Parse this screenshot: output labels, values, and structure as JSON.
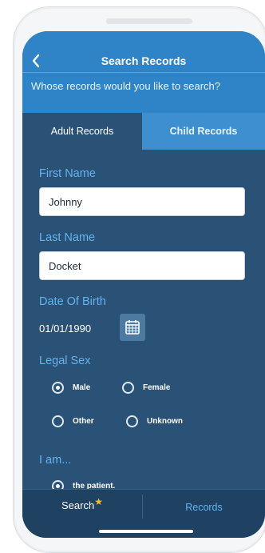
{
  "header": {
    "title": "Search Records",
    "back_icon": "chevron-left-icon",
    "subtitle": "Whose records would you like to search?"
  },
  "tabs": [
    {
      "label": "Adult Records",
      "active": true
    },
    {
      "label": "Child Records",
      "active": false
    }
  ],
  "form": {
    "first_name": {
      "label": "First Name",
      "value": "Johnny"
    },
    "last_name": {
      "label": "Last Name",
      "value": "Docket"
    },
    "dob": {
      "label": "Date Of Birth",
      "value": "01/01/1990",
      "icon": "calendar-icon"
    },
    "legal_sex": {
      "label": "Legal Sex",
      "options": [
        {
          "label": "Male",
          "selected": true
        },
        {
          "label": "Female",
          "selected": false
        },
        {
          "label": "Other",
          "selected": false
        },
        {
          "label": "Unknown",
          "selected": false
        }
      ]
    },
    "i_am": {
      "label": "I am...",
      "options": [
        {
          "label": "the patient.",
          "selected": true
        }
      ]
    }
  },
  "bottom_nav": {
    "search_label": "Search",
    "search_star_icon": "star-icon",
    "records_label": "Records"
  },
  "colors": {
    "header_blue": "#2f84c8",
    "panel_navy": "#2a5276",
    "accent_label": "#64b3ee",
    "star": "#f6c519"
  }
}
